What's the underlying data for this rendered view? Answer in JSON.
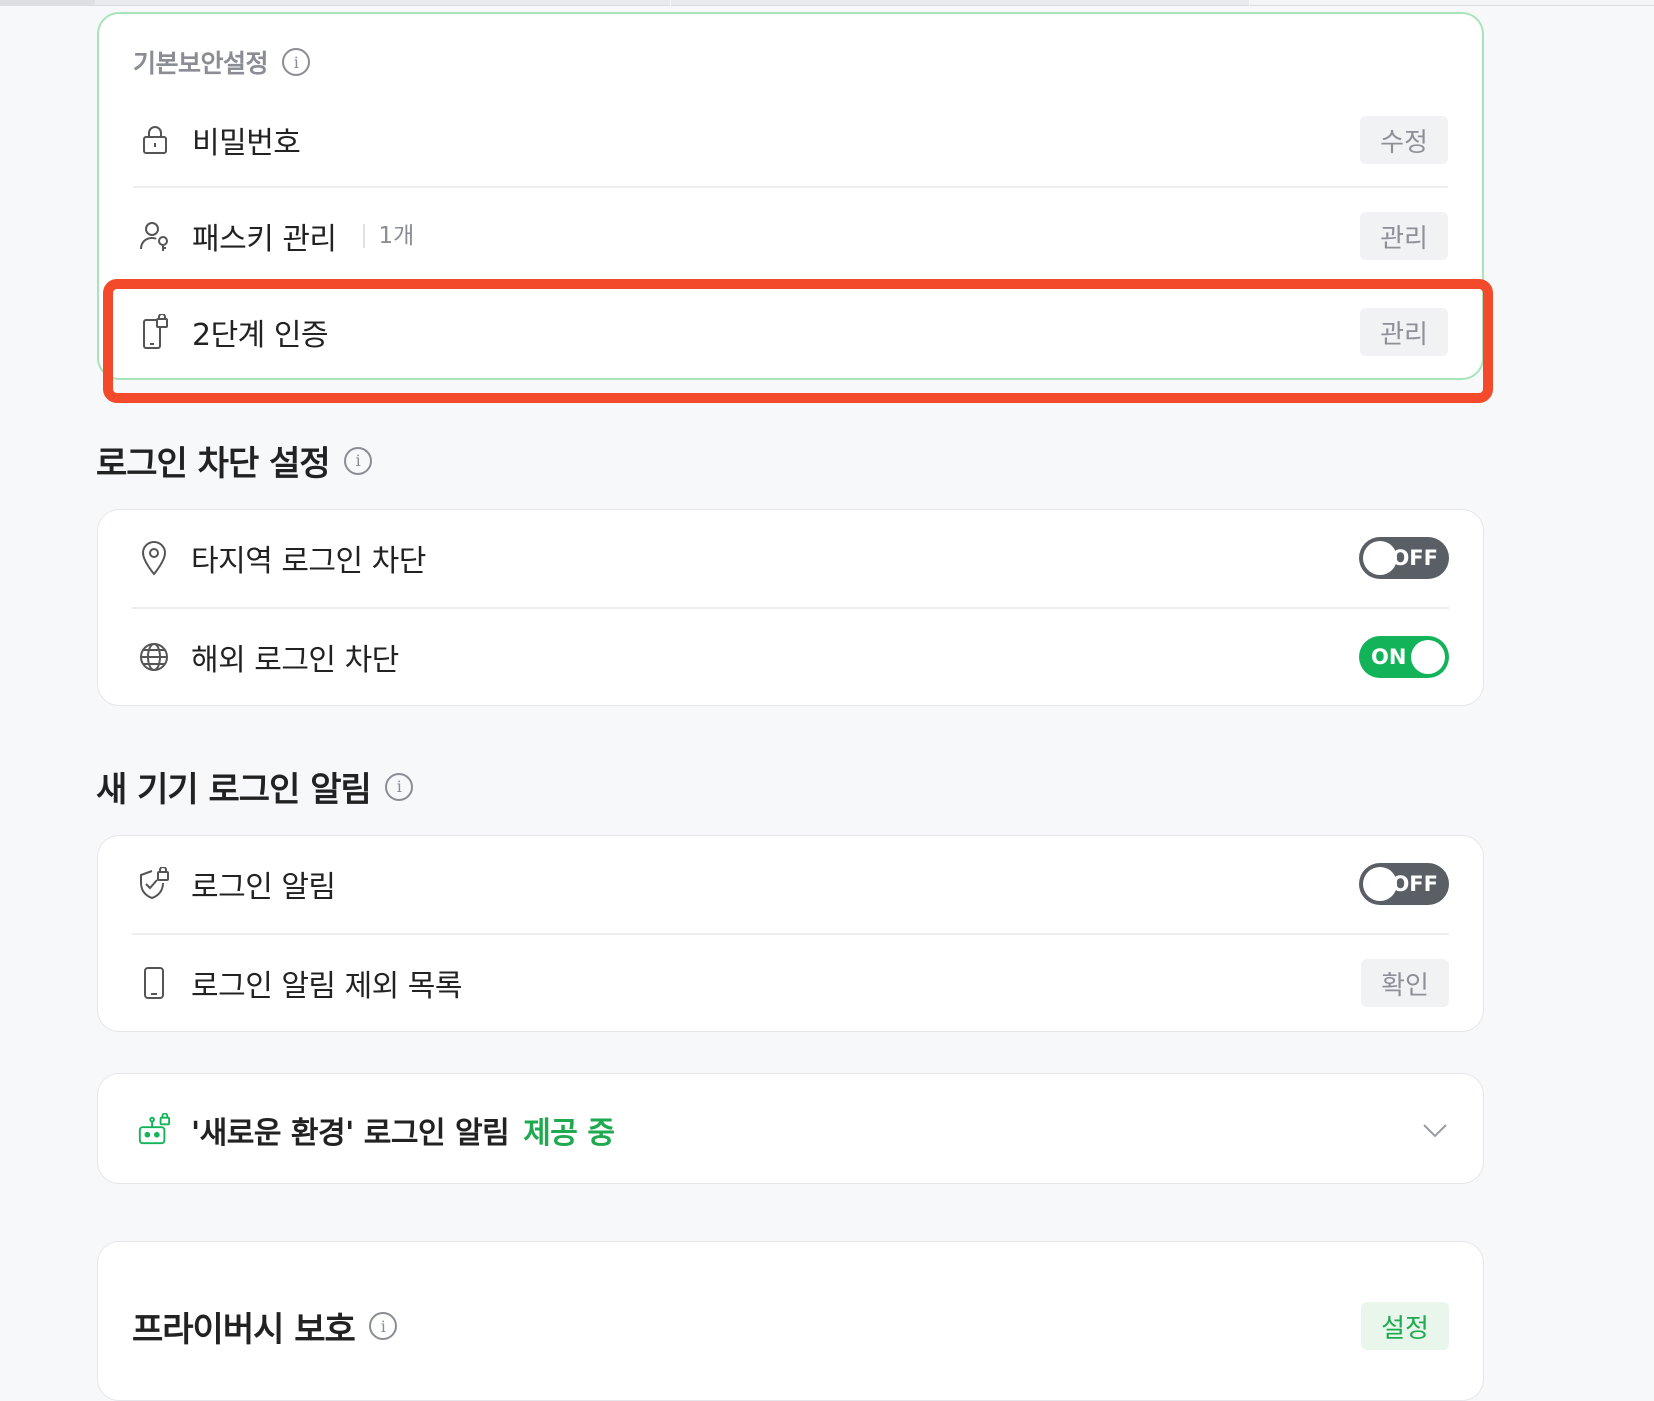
{
  "basic_security": {
    "title": "기본보안설정",
    "rows": [
      {
        "label": "비밀번호",
        "button": "수정"
      },
      {
        "label": "패스키 관리",
        "sub": "1개",
        "button": "관리"
      },
      {
        "label": "2단계 인증",
        "button": "관리"
      }
    ]
  },
  "login_block": {
    "title": "로그인 차단 설정",
    "rows": [
      {
        "label": "타지역 로그인 차단",
        "toggle": "OFF"
      },
      {
        "label": "해외 로그인 차단",
        "toggle": "ON"
      }
    ]
  },
  "new_device": {
    "title": "새 기기 로그인 알림",
    "rows": [
      {
        "label": "로그인 알림",
        "toggle": "OFF"
      },
      {
        "label": "로그인 알림 제외 목록",
        "button": "확인"
      }
    ]
  },
  "new_env": {
    "label": "'새로운 환경' 로그인 알림",
    "status": "제공 중"
  },
  "privacy": {
    "title": "프라이버시 보호",
    "button": "설정"
  },
  "colors": {
    "accent_green": "#13b35a",
    "highlight_red": "#f24a2a"
  }
}
